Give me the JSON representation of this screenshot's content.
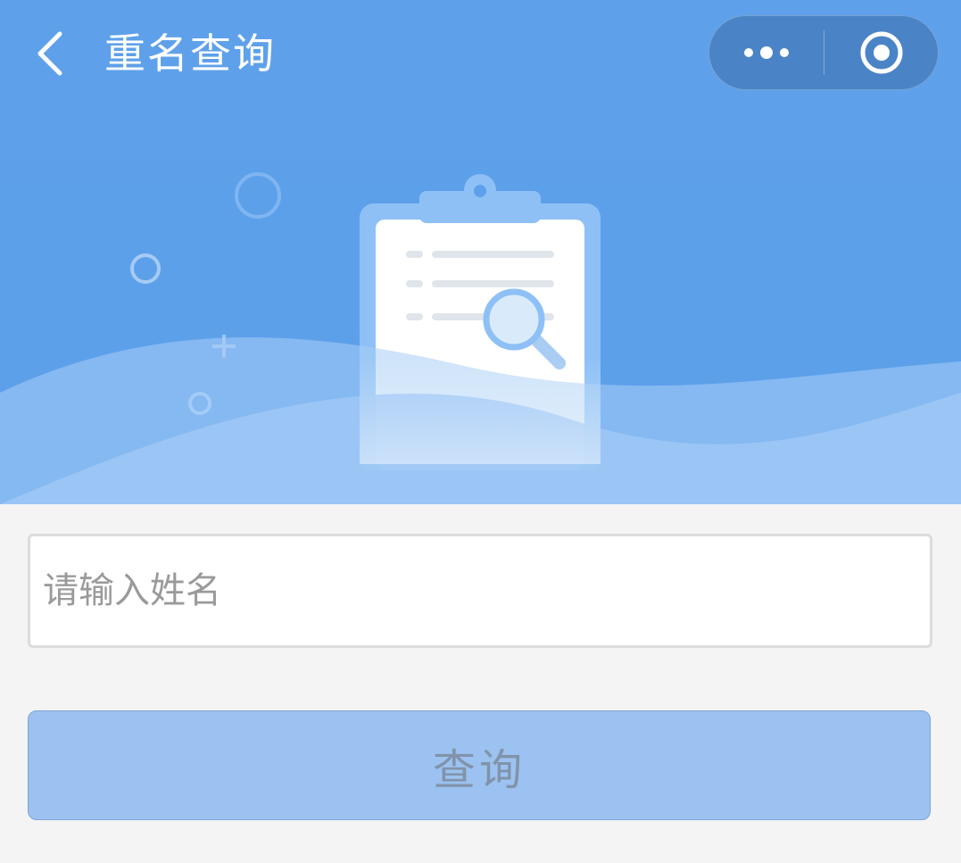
{
  "navbar": {
    "title": "重名查询",
    "back_icon": "chevron-left-icon",
    "more_icon": "more-dots-icon",
    "close_icon": "target-circle-icon"
  },
  "banner": {
    "illustration": "clipboard-search-illustration"
  },
  "form": {
    "name_input": {
      "value": "",
      "placeholder": "请输入姓名"
    },
    "query_button_label": "查询"
  },
  "colors": {
    "header_blue": "#5ea1ea",
    "wave_light": "#9dc7f5",
    "button_fill": "#9bc2f0",
    "page_background": "#f4f4f4"
  }
}
